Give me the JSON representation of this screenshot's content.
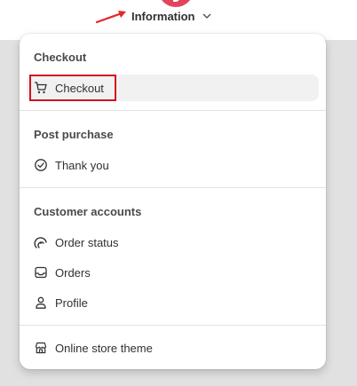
{
  "header": {
    "selector_label": "Information",
    "selector_icon": "chevron-down-icon",
    "annotation_color": "#e0282b"
  },
  "menu": {
    "sections": [
      {
        "title": "Checkout",
        "items": [
          {
            "label": "Checkout",
            "icon": "cart-icon",
            "active": true
          }
        ]
      },
      {
        "title": "Post purchase",
        "items": [
          {
            "label": "Thank you",
            "icon": "check-circle-icon"
          }
        ]
      },
      {
        "title": "Customer accounts",
        "items": [
          {
            "label": "Order status",
            "icon": "order-status-icon"
          },
          {
            "label": "Orders",
            "icon": "inbox-icon"
          },
          {
            "label": "Profile",
            "icon": "person-icon"
          }
        ]
      },
      {
        "items": [
          {
            "label": "Online store theme",
            "icon": "store-icon"
          }
        ]
      }
    ]
  },
  "colors": {
    "highlight_border": "#d0121f",
    "active_item_bg": "#f1f1f1",
    "backdrop": "#e1e1e1"
  }
}
